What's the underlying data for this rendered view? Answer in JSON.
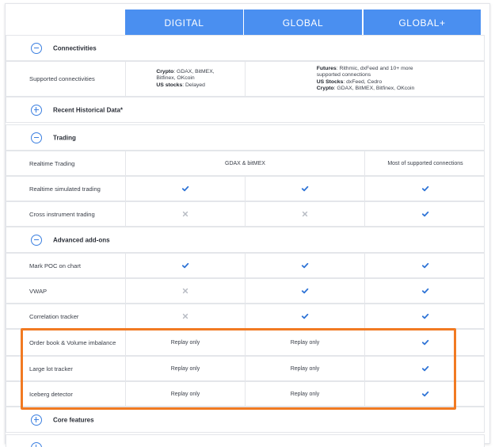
{
  "columns": [
    "DIGITAL",
    "GLOBAL",
    "GLOBAL+"
  ],
  "accent_color": "#4a8ff0",
  "highlight_color": "#f17a22",
  "sections": {
    "connectivities": "Connectivities",
    "historical": "Recent Historical Data*",
    "trading": "Trading",
    "addons": "Advanced add-ons",
    "core": "Core features"
  },
  "supported": {
    "label": "Supported connectivities",
    "digital": {
      "crypto_key": "Crypto",
      "crypto_val": ": GDAX, BitMEX,",
      "crypto_val2": "Bitfinex, OKcoin",
      "stocks_key": "US stocks",
      "stocks_val": ": Delayed"
    },
    "global": {
      "futures_key": "Futures",
      "futures_val": ": Rithmic, dxFeed and 10+ more",
      "futures_val2": "supported connections",
      "stocks_key": "US Stocks",
      "stocks_val": ": dxFeed, Cedro",
      "crypto_key": "Crypto",
      "crypto_val": ": GDAX, BitMEX, Bitfinex, OKcoin"
    }
  },
  "rows": {
    "realtime_trading": {
      "label": "Realtime Trading",
      "digital_global": "GDAX & bitMEX",
      "globalplus": "Most of supported connections"
    },
    "realtime_sim": {
      "label": "Realtime simulated trading",
      "digital": "check",
      "global": "check",
      "globalplus": "check"
    },
    "cross": {
      "label": "Cross instrument trading",
      "digital": "cross",
      "global": "cross",
      "globalplus": "check"
    },
    "poc": {
      "label": "Mark POC on chart",
      "digital": "check",
      "global": "check",
      "globalplus": "check"
    },
    "vwap": {
      "label": "VWAP",
      "digital": "cross",
      "global": "check",
      "globalplus": "check"
    },
    "correlation": {
      "label": "Correlation tracker",
      "digital": "cross",
      "global": "check",
      "globalplus": "check"
    },
    "orderbook": {
      "label": "Order book & Volume imbalance",
      "digital": "Replay only",
      "global": "Replay only",
      "globalplus": "check"
    },
    "largelot": {
      "label": "Large lot tracker",
      "digital": "Replay only",
      "global": "Replay only",
      "globalplus": "check"
    },
    "iceberg": {
      "label": "Iceberg detector",
      "digital": "Replay only",
      "global": "Replay only",
      "globalplus": "check"
    }
  }
}
